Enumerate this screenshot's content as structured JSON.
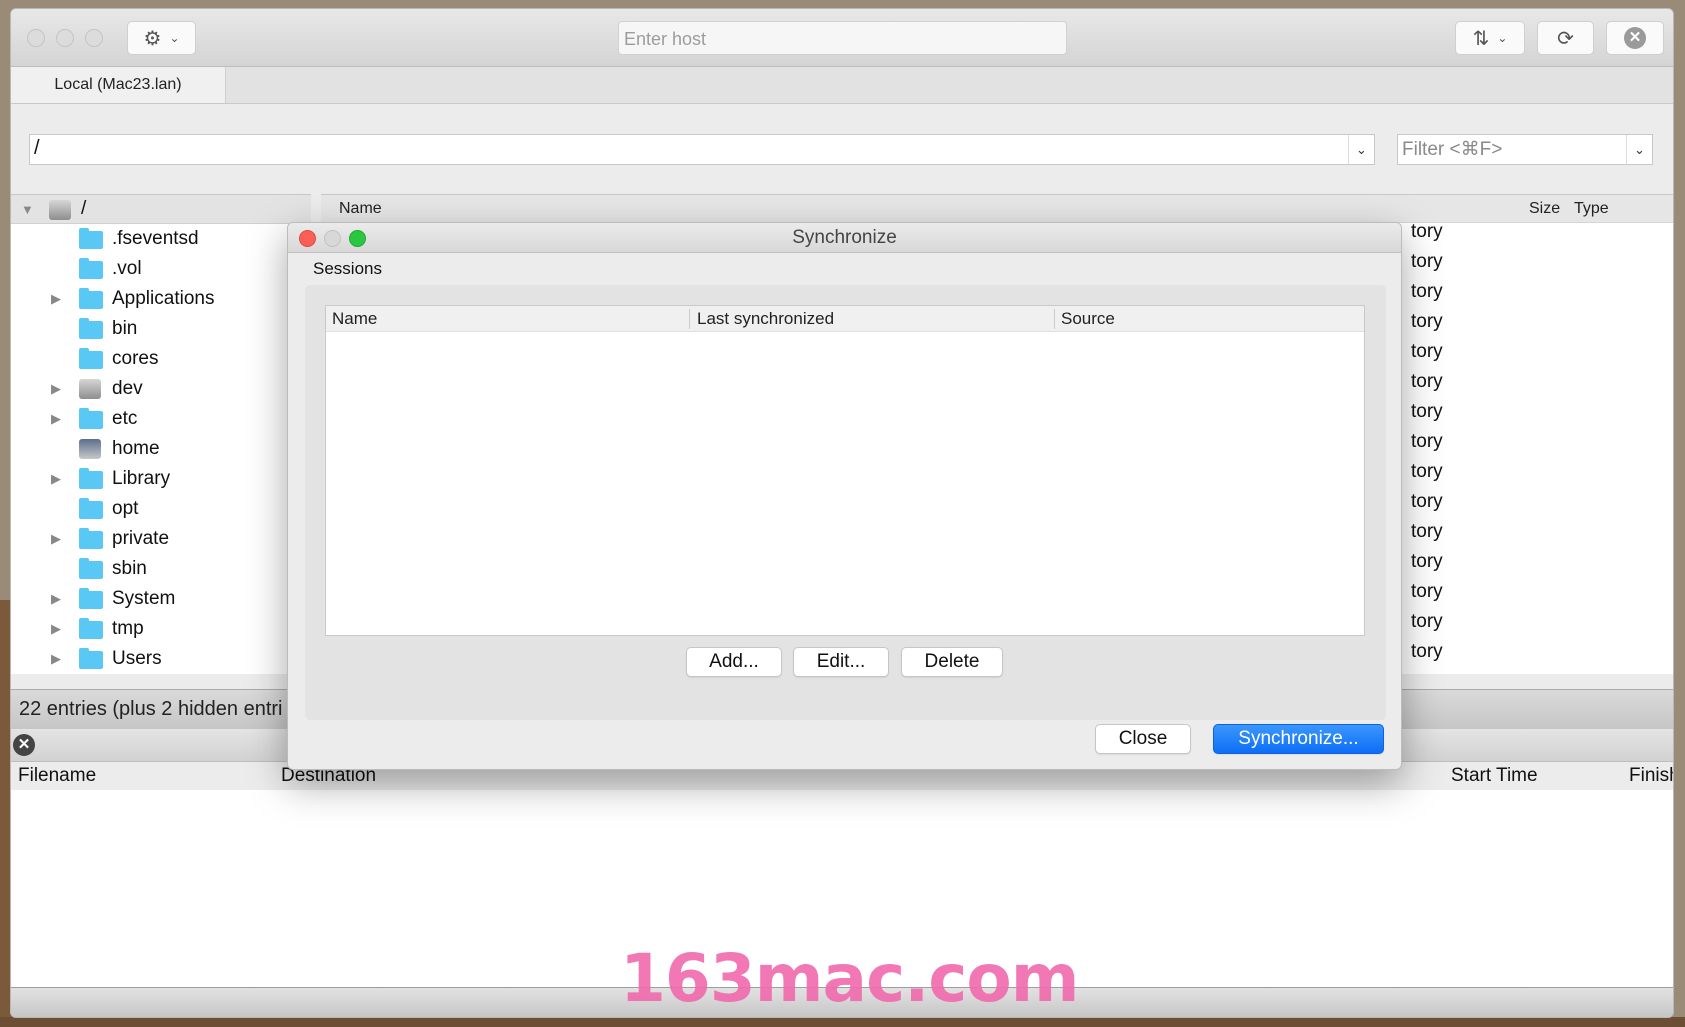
{
  "toolbar": {
    "settings_icon": "gear-icon",
    "host_placeholder": "Enter host",
    "transfer_icon": "up-down-arrows-icon",
    "refresh_icon": "refresh-icon",
    "disconnect_icon": "close-circle-icon"
  },
  "tab": {
    "label": "Local (Mac23.lan)"
  },
  "path": {
    "value": "/",
    "filter_placeholder": "Filter <⌘F>"
  },
  "tree": {
    "root": "/",
    "items": [
      {
        "name": ".fseventsd",
        "expandable": false,
        "icon": "folder-restricted-icon"
      },
      {
        "name": ".vol",
        "expandable": false,
        "icon": "folder-icon"
      },
      {
        "name": "Applications",
        "expandable": true,
        "icon": "applications-folder-icon"
      },
      {
        "name": "bin",
        "expandable": false,
        "icon": "folder-icon"
      },
      {
        "name": "cores",
        "expandable": false,
        "icon": "folder-icon"
      },
      {
        "name": "dev",
        "expandable": true,
        "icon": "disk-icon"
      },
      {
        "name": "etc",
        "expandable": true,
        "icon": "folder-icon"
      },
      {
        "name": "home",
        "expandable": false,
        "icon": "network-drive-icon"
      },
      {
        "name": "Library",
        "expandable": true,
        "icon": "library-folder-icon"
      },
      {
        "name": "opt",
        "expandable": false,
        "icon": "folder-icon"
      },
      {
        "name": "private",
        "expandable": true,
        "icon": "folder-icon"
      },
      {
        "name": "sbin",
        "expandable": false,
        "icon": "folder-icon"
      },
      {
        "name": "System",
        "expandable": true,
        "icon": "system-folder-icon"
      },
      {
        "name": "tmp",
        "expandable": true,
        "icon": "folder-icon"
      },
      {
        "name": "Users",
        "expandable": true,
        "icon": "users-folder-icon"
      }
    ]
  },
  "list": {
    "columns": [
      "Name",
      "Size",
      "Type"
    ],
    "type_values": [
      "tory",
      "tory",
      "tory",
      "tory",
      "tory",
      "tory",
      "tory",
      "tory",
      "tory",
      "tory",
      "tory",
      "tory",
      "tory",
      "tory",
      "tory"
    ]
  },
  "status": {
    "text": "22 entries (plus 2 hidden entri"
  },
  "queue": {
    "columns": [
      "Filename",
      "Destination",
      "Start Time",
      "Finish"
    ]
  },
  "dialog": {
    "title": "Synchronize",
    "sessions_label": "Sessions",
    "columns": [
      "Name",
      "Last synchronized",
      "Source"
    ],
    "add": "Add...",
    "edit": "Edit...",
    "delete": "Delete",
    "close": "Close",
    "synchronize": "Synchronize..."
  },
  "watermark": "163mac.com"
}
